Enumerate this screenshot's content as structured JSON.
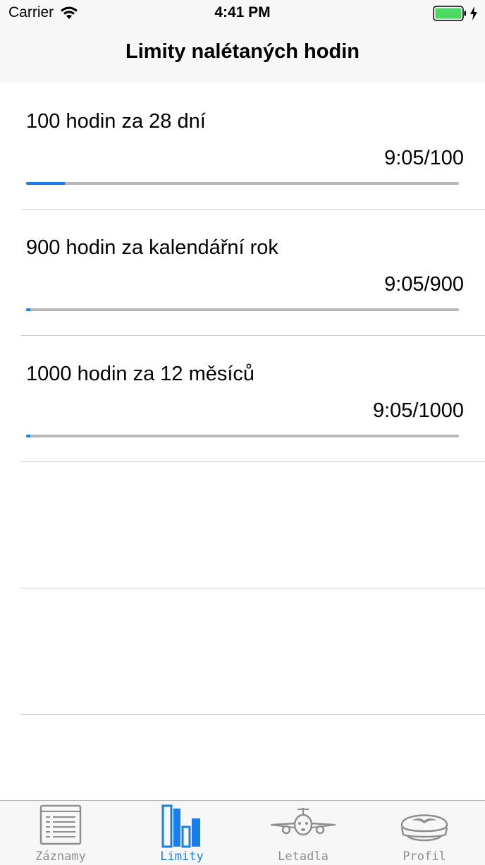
{
  "status_bar": {
    "carrier": "Carrier",
    "time": "4:41 PM"
  },
  "nav": {
    "title": "Limity nalétaných hodin"
  },
  "limits": [
    {
      "title": "100 hodin za 28 dní",
      "value": "9:05/100",
      "progress": 0.09
    },
    {
      "title": "900 hodin za kalendářní rok",
      "value": "9:05/900",
      "progress": 0.01
    },
    {
      "title": "1000 hodin za 12 měsíců",
      "value": "9:05/1000",
      "progress": 0.009
    }
  ],
  "tabs": [
    {
      "label": "Záznamy",
      "icon": "list-icon",
      "active": false
    },
    {
      "label": "Limity",
      "icon": "bar-chart-icon",
      "active": true
    },
    {
      "label": "Letadla",
      "icon": "airplane-icon",
      "active": false
    },
    {
      "label": "Profil",
      "icon": "pilot-cap-icon",
      "active": false
    }
  ],
  "colors": {
    "accent": "#1a7ee8",
    "inactive": "#8e8e8e",
    "battery": "#4cd964"
  }
}
